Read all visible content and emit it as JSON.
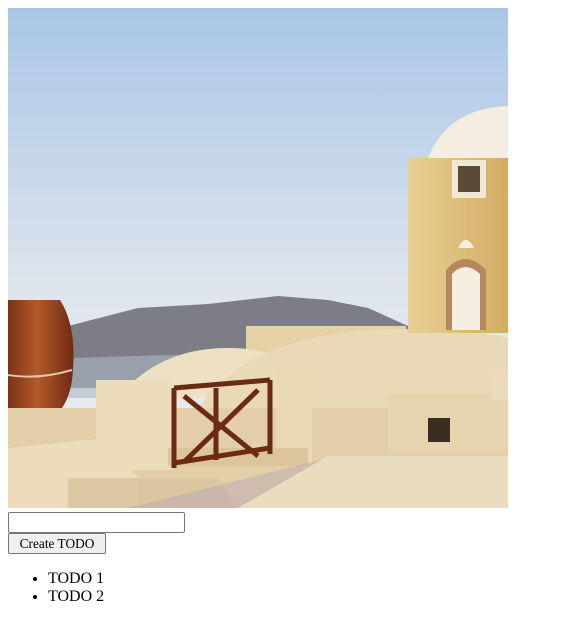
{
  "hero_image": {
    "alt": "Santorini",
    "colors": {
      "sky_top": "#a9c6e6",
      "sky_bottom": "#eef0ec",
      "mountain": "#7c7d85",
      "sea": "#aab7c4",
      "wall": "#e8d9b8",
      "wall_shadow": "#c9b58e",
      "tower": "#dfc07d",
      "pot": "#a24a22",
      "railing": "#6b2a14"
    }
  },
  "form": {
    "input_value": "",
    "input_placeholder": "",
    "create_label": "Create TODO"
  },
  "todos": [
    {
      "label": "TODO 1"
    },
    {
      "label": "TODO 2"
    }
  ]
}
